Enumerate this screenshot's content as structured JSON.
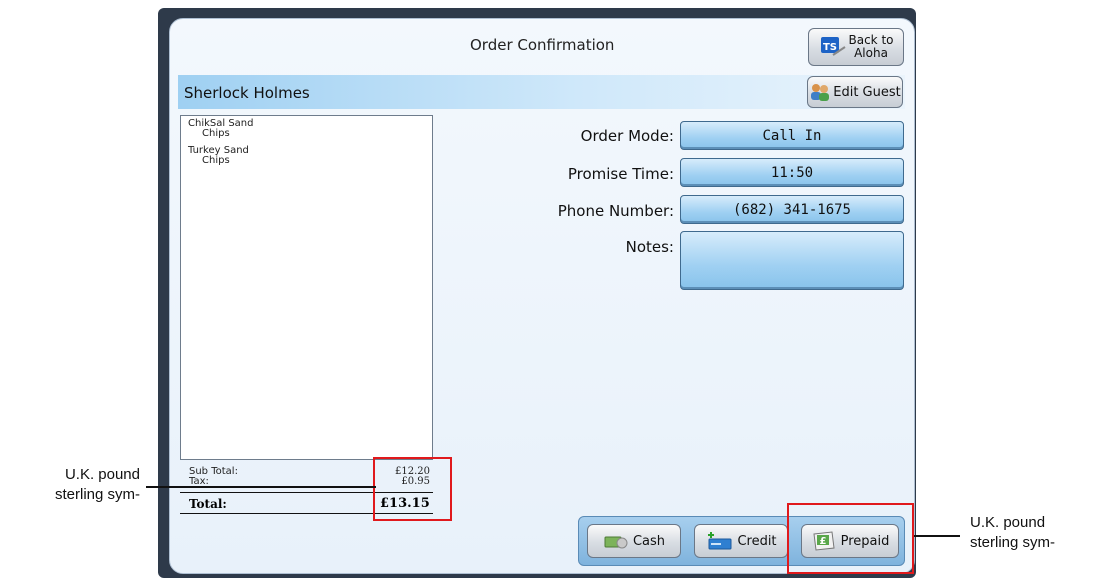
{
  "header": {
    "title": "Order Confirmation",
    "back_label_1": "Back to",
    "back_label_2": "Aloha"
  },
  "guest": {
    "name": "Sherlock Holmes",
    "edit_label": "Edit Guest"
  },
  "receipt": {
    "items": [
      {
        "name": "ChikSal Sand",
        "mod": "Chips"
      },
      {
        "name": "Turkey Sand",
        "mod": "Chips"
      }
    ],
    "subtotal_label": "Sub Total:",
    "subtotal_value": "£12.20",
    "tax_label": "Tax:",
    "tax_value": "£0.95",
    "total_label": "Total:",
    "total_value": "£13.15"
  },
  "order": {
    "mode_label": "Order Mode:",
    "mode_value": "Call In",
    "promise_label": "Promise Time:",
    "promise_value": "11:50",
    "phone_label": "Phone Number:",
    "phone_value": "(682) 341-1675",
    "notes_label": "Notes:",
    "notes_value": ""
  },
  "payment": {
    "cash": "Cash",
    "credit": "Credit",
    "prepaid": "Prepaid"
  },
  "annotations": {
    "left_1": "U.K. pound",
    "left_2": "sterling sym-",
    "right_1": "U.K. pound",
    "right_2": "sterling sym-",
    "highlight_color": "#e0191c"
  }
}
